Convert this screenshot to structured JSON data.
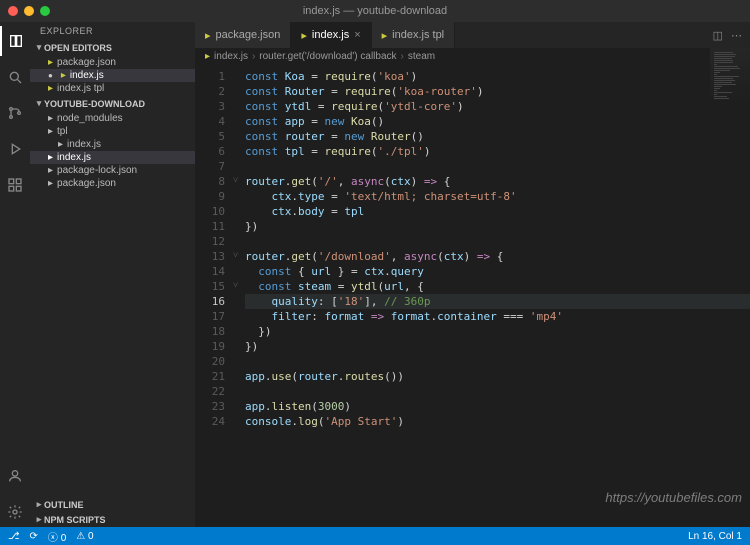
{
  "window": {
    "title": "index.js — youtube-download"
  },
  "sidebar": {
    "title": "EXPLORER",
    "open_editors_label": "OPEN EDITORS",
    "open_editors": [
      {
        "label": "package.json",
        "dirty": false
      },
      {
        "label": "index.js",
        "dirty": true
      },
      {
        "label": "index.js tpl",
        "dirty": false
      }
    ],
    "project_label": "YOUTUBE-DOWNLOAD",
    "tree": [
      {
        "label": "node_modules",
        "kind": "folder"
      },
      {
        "label": "tpl",
        "kind": "folder"
      },
      {
        "label": "index.js",
        "kind": "file",
        "indent": 1
      },
      {
        "label": "index.js",
        "kind": "file",
        "active": true
      },
      {
        "label": "package-lock.json",
        "kind": "file"
      },
      {
        "label": "package.json",
        "kind": "file"
      }
    ],
    "outline_label": "OUTLINE",
    "npm_scripts_label": "NPM SCRIPTS"
  },
  "tabs": [
    {
      "label": "package.json",
      "active": false
    },
    {
      "label": "index.js",
      "active": true,
      "dirty": true
    },
    {
      "label": "index.js tpl",
      "active": false
    }
  ],
  "breadcrumb": {
    "parts": [
      "index.js",
      "router.get('/download') callback",
      "steam"
    ]
  },
  "code": {
    "current_line": 16,
    "lines": [
      {
        "n": 1,
        "seg": [
          [
            "tk-const",
            "const "
          ],
          [
            "tk-var",
            "Koa"
          ],
          [
            "tk-punc",
            " = "
          ],
          [
            "tk-fn",
            "require"
          ],
          [
            "tk-punc",
            "("
          ],
          [
            "tk-str",
            "'koa'"
          ],
          [
            "tk-punc",
            ")"
          ]
        ]
      },
      {
        "n": 2,
        "seg": [
          [
            "tk-const",
            "const "
          ],
          [
            "tk-var",
            "Router"
          ],
          [
            "tk-punc",
            " = "
          ],
          [
            "tk-fn",
            "require"
          ],
          [
            "tk-punc",
            "("
          ],
          [
            "tk-str",
            "'koa-router'"
          ],
          [
            "tk-punc",
            ")"
          ]
        ]
      },
      {
        "n": 3,
        "seg": [
          [
            "tk-const",
            "const "
          ],
          [
            "tk-var",
            "ytdl"
          ],
          [
            "tk-punc",
            " = "
          ],
          [
            "tk-fn",
            "require"
          ],
          [
            "tk-punc",
            "("
          ],
          [
            "tk-str",
            "'ytdl-core'"
          ],
          [
            "tk-punc",
            ")"
          ]
        ]
      },
      {
        "n": 4,
        "seg": [
          [
            "tk-const",
            "const "
          ],
          [
            "tk-var",
            "app"
          ],
          [
            "tk-punc",
            " = "
          ],
          [
            "tk-new",
            "new "
          ],
          [
            "tk-fn",
            "Koa"
          ],
          [
            "tk-punc",
            "()"
          ]
        ]
      },
      {
        "n": 5,
        "seg": [
          [
            "tk-const",
            "const "
          ],
          [
            "tk-var",
            "router"
          ],
          [
            "tk-punc",
            " = "
          ],
          [
            "tk-new",
            "new "
          ],
          [
            "tk-fn",
            "Router"
          ],
          [
            "tk-punc",
            "()"
          ]
        ]
      },
      {
        "n": 6,
        "seg": [
          [
            "tk-const",
            "const "
          ],
          [
            "tk-var",
            "tpl"
          ],
          [
            "tk-punc",
            " = "
          ],
          [
            "tk-fn",
            "require"
          ],
          [
            "tk-punc",
            "("
          ],
          [
            "tk-str",
            "'./tpl'"
          ],
          [
            "tk-punc",
            ")"
          ]
        ]
      },
      {
        "n": 7,
        "seg": [
          [
            "",
            ""
          ]
        ]
      },
      {
        "n": 8,
        "fold": "v",
        "seg": [
          [
            "tk-var",
            "router"
          ],
          [
            "tk-punc",
            "."
          ],
          [
            "tk-fn",
            "get"
          ],
          [
            "tk-punc",
            "("
          ],
          [
            "tk-str",
            "'/'"
          ],
          [
            "tk-punc",
            ", "
          ],
          [
            "tk-kw",
            "async"
          ],
          [
            "tk-punc",
            "("
          ],
          [
            "tk-var",
            "ctx"
          ],
          [
            "tk-punc",
            ") "
          ],
          [
            "tk-kw",
            "=>"
          ],
          [
            "tk-punc",
            " {"
          ]
        ]
      },
      {
        "n": 9,
        "seg": [
          [
            "",
            "    "
          ],
          [
            "tk-var",
            "ctx"
          ],
          [
            "tk-punc",
            "."
          ],
          [
            "tk-prop",
            "type"
          ],
          [
            "tk-punc",
            " = "
          ],
          [
            "tk-str",
            "'text/html; charset=utf-8'"
          ]
        ]
      },
      {
        "n": 10,
        "seg": [
          [
            "",
            "    "
          ],
          [
            "tk-var",
            "ctx"
          ],
          [
            "tk-punc",
            "."
          ],
          [
            "tk-prop",
            "body"
          ],
          [
            "tk-punc",
            " = "
          ],
          [
            "tk-var",
            "tpl"
          ]
        ]
      },
      {
        "n": 11,
        "seg": [
          [
            "tk-punc",
            "})"
          ]
        ]
      },
      {
        "n": 12,
        "seg": [
          [
            "",
            ""
          ]
        ]
      },
      {
        "n": 13,
        "fold": "v",
        "seg": [
          [
            "tk-var",
            "router"
          ],
          [
            "tk-punc",
            "."
          ],
          [
            "tk-fn",
            "get"
          ],
          [
            "tk-punc",
            "("
          ],
          [
            "tk-str",
            "'/download'"
          ],
          [
            "tk-punc",
            ", "
          ],
          [
            "tk-kw",
            "async"
          ],
          [
            "tk-punc",
            "("
          ],
          [
            "tk-var",
            "ctx"
          ],
          [
            "tk-punc",
            ") "
          ],
          [
            "tk-kw",
            "=>"
          ],
          [
            "tk-punc",
            " {"
          ]
        ]
      },
      {
        "n": 14,
        "seg": [
          [
            "",
            "  "
          ],
          [
            "tk-const",
            "const "
          ],
          [
            "tk-punc",
            "{ "
          ],
          [
            "tk-var",
            "url"
          ],
          [
            "tk-punc",
            " } = "
          ],
          [
            "tk-var",
            "ctx"
          ],
          [
            "tk-punc",
            "."
          ],
          [
            "tk-prop",
            "query"
          ]
        ]
      },
      {
        "n": 15,
        "fold": "v",
        "seg": [
          [
            "",
            "  "
          ],
          [
            "tk-const",
            "const "
          ],
          [
            "tk-var",
            "steam"
          ],
          [
            "tk-punc",
            " = "
          ],
          [
            "tk-fn",
            "ytdl"
          ],
          [
            "tk-punc",
            "("
          ],
          [
            "tk-var",
            "url"
          ],
          [
            "tk-punc",
            ", {"
          ]
        ]
      },
      {
        "n": 16,
        "current": true,
        "seg": [
          [
            "",
            "    "
          ],
          [
            "tk-prop",
            "quality"
          ],
          [
            "tk-punc",
            ": ["
          ],
          [
            "tk-str",
            "'18'"
          ],
          [
            "tk-punc",
            "], "
          ],
          [
            "tk-cmt",
            "// 360p"
          ]
        ]
      },
      {
        "n": 17,
        "seg": [
          [
            "",
            "    "
          ],
          [
            "tk-prop",
            "filter"
          ],
          [
            "tk-punc",
            ": "
          ],
          [
            "tk-var",
            "format"
          ],
          [
            "tk-punc",
            " "
          ],
          [
            "tk-kw",
            "=>"
          ],
          [
            "tk-punc",
            " "
          ],
          [
            "tk-var",
            "format"
          ],
          [
            "tk-punc",
            "."
          ],
          [
            "tk-prop",
            "container"
          ],
          [
            "tk-punc",
            " === "
          ],
          [
            "tk-str",
            "'mp4'"
          ]
        ]
      },
      {
        "n": 18,
        "seg": [
          [
            "",
            "  "
          ],
          [
            "tk-punc",
            "})"
          ]
        ]
      },
      {
        "n": 19,
        "seg": [
          [
            "tk-punc",
            "})"
          ]
        ]
      },
      {
        "n": 20,
        "seg": [
          [
            "",
            ""
          ]
        ]
      },
      {
        "n": 21,
        "seg": [
          [
            "tk-var",
            "app"
          ],
          [
            "tk-punc",
            "."
          ],
          [
            "tk-fn",
            "use"
          ],
          [
            "tk-punc",
            "("
          ],
          [
            "tk-var",
            "router"
          ],
          [
            "tk-punc",
            "."
          ],
          [
            "tk-fn",
            "routes"
          ],
          [
            "tk-punc",
            "())"
          ]
        ]
      },
      {
        "n": 22,
        "seg": [
          [
            "",
            ""
          ]
        ]
      },
      {
        "n": 23,
        "seg": [
          [
            "tk-var",
            "app"
          ],
          [
            "tk-punc",
            "."
          ],
          [
            "tk-fn",
            "listen"
          ],
          [
            "tk-punc",
            "("
          ],
          [
            "tk-num",
            "3000"
          ],
          [
            "tk-punc",
            ")"
          ]
        ]
      },
      {
        "n": 24,
        "seg": [
          [
            "tk-var",
            "console"
          ],
          [
            "tk-punc",
            "."
          ],
          [
            "tk-fn",
            "log"
          ],
          [
            "tk-punc",
            "("
          ],
          [
            "tk-str",
            "'App Start'"
          ],
          [
            "tk-punc",
            ")"
          ]
        ]
      }
    ]
  },
  "statusbar": {
    "branch_icon": "⎇",
    "errors": "0",
    "warnings": "0",
    "position": "Ln 16, Col 1",
    "watermark": "https://youtubefiles.com"
  }
}
